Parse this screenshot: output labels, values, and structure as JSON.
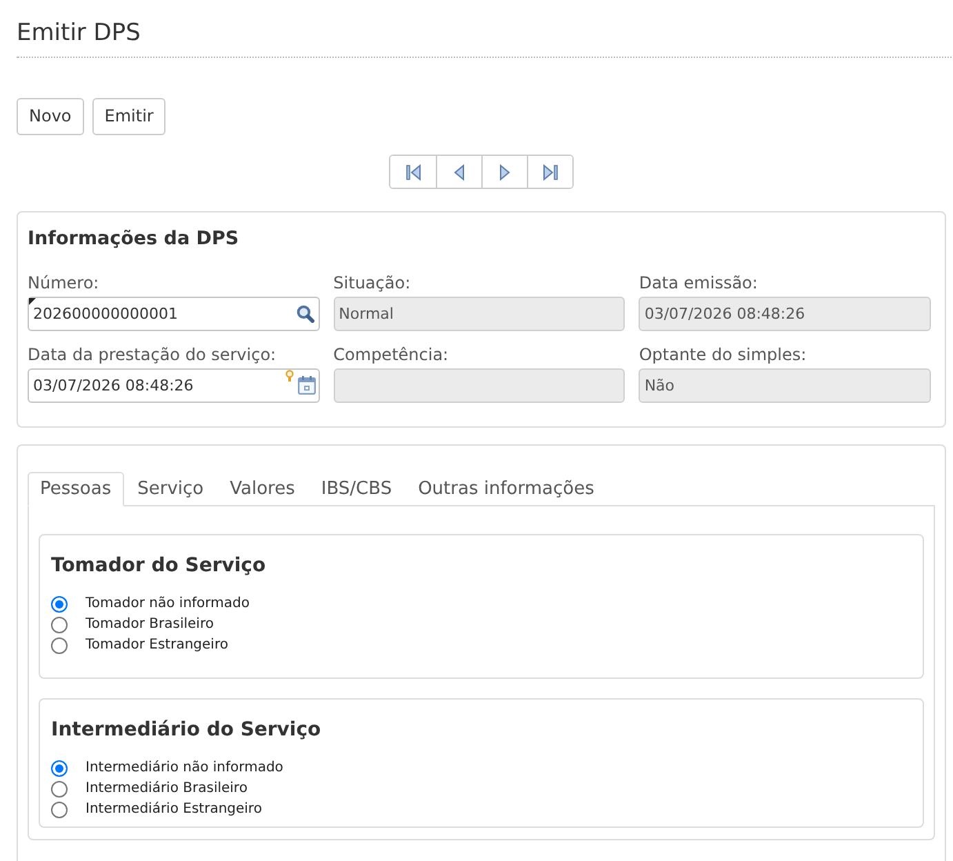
{
  "page": {
    "title": "Emitir DPS"
  },
  "toolbar": {
    "buttons": [
      "Novo",
      "Emitir"
    ]
  },
  "pager": {
    "buttons": [
      {
        "kind": "first"
      },
      {
        "kind": "previous"
      },
      {
        "kind": "next"
      },
      {
        "kind": "last"
      }
    ]
  },
  "dps_info": {
    "title": "Informações da DPS",
    "fields": [
      {
        "label": "Número:",
        "value": "202600000000001",
        "disabled": false,
        "marked": true,
        "kind": "search"
      },
      {
        "label": "Situação:",
        "value": "Normal",
        "disabled": true,
        "marked": false,
        "kind": "text"
      },
      {
        "label": "Data emissão:",
        "value": "03/07/2026 08:48:26",
        "disabled": true,
        "marked": false,
        "kind": "text"
      },
      {
        "label": "Data da prestação do serviço:",
        "value": "03/07/2026 08:48:26",
        "disabled": false,
        "marked": false,
        "kind": "date"
      },
      {
        "label": "Competência:",
        "disabled": true,
        "marked": false,
        "kind": "text"
      },
      {
        "label": "Optante do simples:",
        "value": "Não",
        "disabled": true,
        "marked": false,
        "kind": "text"
      }
    ]
  },
  "tabs": [
    {
      "label": "Pessoas",
      "selected": true
    },
    {
      "label": "Serviço",
      "selected": false
    },
    {
      "label": "Valores",
      "selected": false
    },
    {
      "label": "IBS/CBS",
      "selected": false
    },
    {
      "label": "Outras informações",
      "selected": false
    }
  ],
  "sections": [
    {
      "title": "Tomador do Serviço",
      "options": [
        {
          "label": "Tomador não informado",
          "selected": true
        },
        {
          "label": "Tomador Brasileiro",
          "selected": false
        },
        {
          "label": "Tomador Estrangeiro",
          "selected": false
        }
      ]
    },
    {
      "title": "Intermediário do Serviço",
      "options": [
        {
          "label": "Intermediário não informado",
          "selected": true
        },
        {
          "label": "Intermediário Brasileiro",
          "selected": false
        },
        {
          "label": "Intermediário Estrangeiro",
          "selected": false
        }
      ]
    }
  ]
}
